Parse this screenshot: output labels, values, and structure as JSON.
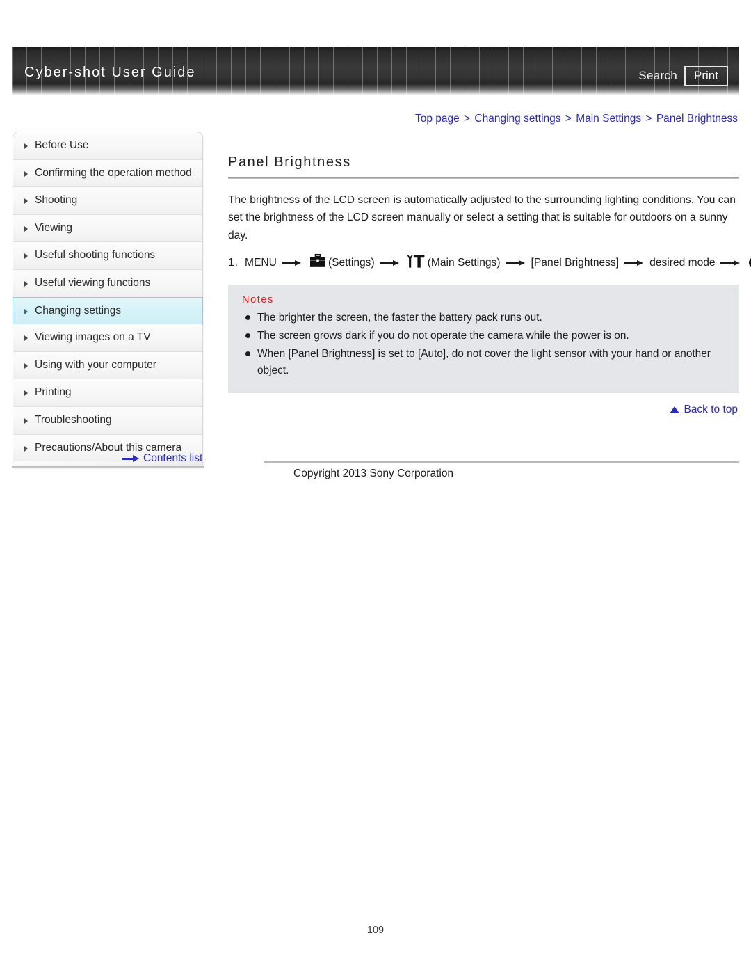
{
  "header": {
    "title": "Cyber-shot User Guide",
    "search_label": "Search",
    "print_label": "Print"
  },
  "breadcrumb": {
    "items": [
      "Top page",
      "Changing settings",
      "Main Settings",
      "Panel Brightness"
    ],
    "separator": ">"
  },
  "sidebar": {
    "items": [
      {
        "label": "Before Use",
        "active": false
      },
      {
        "label": "Confirming the operation method",
        "active": false
      },
      {
        "label": "Shooting",
        "active": false
      },
      {
        "label": "Viewing",
        "active": false
      },
      {
        "label": "Useful shooting functions",
        "active": false
      },
      {
        "label": "Useful viewing functions",
        "active": false
      },
      {
        "label": "Changing settings",
        "active": true
      },
      {
        "label": "Viewing images on a TV",
        "active": false
      },
      {
        "label": "Using with your computer",
        "active": false
      },
      {
        "label": "Printing",
        "active": false
      },
      {
        "label": "Troubleshooting",
        "active": false
      },
      {
        "label": "Precautions/About this camera",
        "active": false
      }
    ],
    "contents_list_label": "Contents list"
  },
  "main": {
    "title": "Panel Brightness",
    "intro": "The brightness of the LCD screen is automatically adjusted to the surrounding lighting conditions. You can set the brightness of the LCD screen manually or select a setting that is suitable for outdoors on a sunny day.",
    "step": {
      "number": "1.",
      "menu_label": "MENU",
      "settings_label": "(Settings)",
      "main_settings_label": "(Main Settings)",
      "panel_brightness_label": "[Panel Brightness]",
      "desired_mode_label": "desired mode"
    },
    "notes": {
      "title": "Notes",
      "items": [
        "The brighter the screen, the faster the battery pack runs out.",
        "The screen grows dark if you do not operate the camera while the power is on.",
        "When [Panel Brightness] is set to [Auto], do not cover the light sensor with your hand or another object."
      ]
    },
    "back_to_top_label": "Back to top"
  },
  "footer": {
    "copyright": "Copyright 2013 Sony Corporation",
    "page_number": "109"
  },
  "colors": {
    "link": "#2b2bc4",
    "notes_title": "#e0201b",
    "notes_bg": "#e4e6e9",
    "active_nav_bg": "#d6f2f8"
  }
}
